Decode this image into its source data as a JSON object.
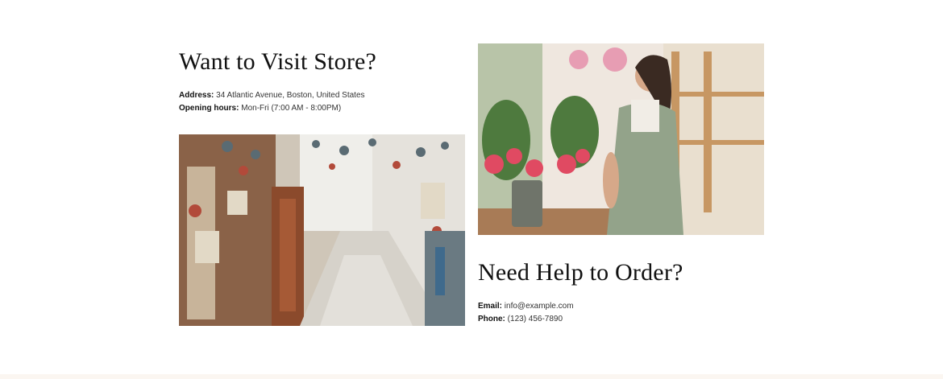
{
  "visit": {
    "title": "Want to Visit Store?",
    "address_label": "Address:",
    "address_value": "34 Atlantic Avenue, Boston, United States",
    "hours_label": "Opening hours:",
    "hours_value": "Mon-Fri (7:00 AM - 8:00PM)"
  },
  "help": {
    "title": "Need Help to Order?",
    "email_label": "Email:",
    "email_value": "info@example.com",
    "phone_label": "Phone:",
    "phone_value": "(123) 456-7890"
  },
  "colors": {
    "background": "#ffffff",
    "footer_strip": "#fbf6f1",
    "heading": "#111111",
    "text": "#333333"
  }
}
